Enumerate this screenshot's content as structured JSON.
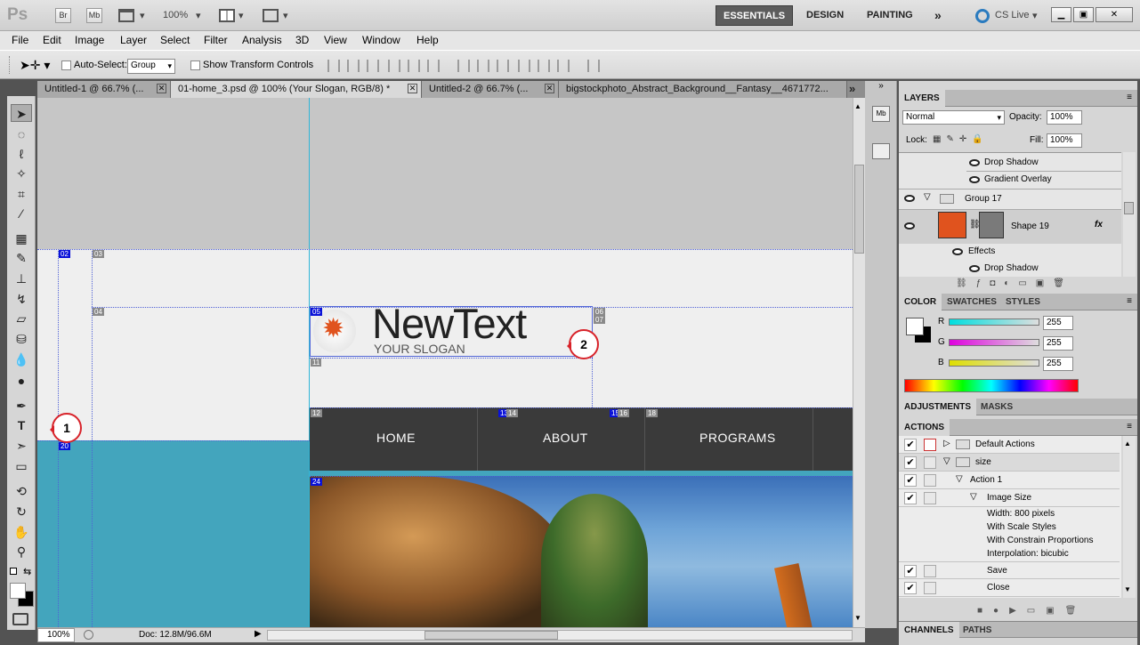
{
  "appbar": {
    "logo": "Ps",
    "bridge": "Br",
    "minibridge": "Mb",
    "zoom": "100%",
    "workspaces": [
      "ESSENTIALS",
      "DESIGN",
      "PAINTING"
    ],
    "more": "»",
    "cslive": "CS Live"
  },
  "menu": [
    "File",
    "Edit",
    "Image",
    "Layer",
    "Select",
    "Filter",
    "Analysis",
    "3D",
    "View",
    "Window",
    "Help"
  ],
  "options": {
    "auto_select_label": "Auto-Select:",
    "auto_select_value": "Group",
    "transform_label": "Show Transform Controls"
  },
  "tabs": [
    {
      "label": "Untitled-1 @ 66.7% (...",
      "close": "✕"
    },
    {
      "label": "01-home_3.psd @ 100% (Your Slogan, RGB/8) *",
      "close": "✕"
    },
    {
      "label": "Untitled-2 @ 66.7% (...",
      "close": "✕"
    },
    {
      "label": "bigstockphoto_Abstract_Background__Fantasy__4671772...",
      "close": "✕"
    }
  ],
  "tabs_more": "»",
  "canvas": {
    "slices": [
      "02",
      "03",
      "04",
      "05",
      "06",
      "07",
      "11",
      "12",
      "13",
      "14",
      "15",
      "16",
      "18",
      "20",
      "24"
    ],
    "logo_text": "NewText",
    "slogan": "YOUR SLOGAN",
    "nav": [
      "HOME",
      "ABOUT",
      "PROGRAMS"
    ],
    "callouts": [
      "1",
      "2"
    ]
  },
  "status": {
    "zoom": "100%",
    "doc": "Doc: 12.8M/96.6M"
  },
  "layers_panel": {
    "tab": "LAYERS",
    "blend": "Normal",
    "opacity_label": "Opacity:",
    "opacity": "100%",
    "lock_label": "Lock:",
    "fill_label": "Fill:",
    "fill": "100%",
    "rows": [
      "Drop Shadow",
      "Gradient Overlay",
      "Group 17",
      "Shape 19",
      "Effects",
      "Drop Shadow"
    ],
    "fx": "fx"
  },
  "color_panel": {
    "tabs": [
      "COLOR",
      "SWATCHES",
      "STYLES"
    ],
    "channels": [
      {
        "label": "R",
        "value": "255",
        "color": "#00e8e8"
      },
      {
        "label": "G",
        "value": "255",
        "color": "#e800e8"
      },
      {
        "label": "B",
        "value": "255",
        "color": "#e8e800"
      }
    ]
  },
  "adjust_tabs": [
    "ADJUSTMENTS",
    "MASKS"
  ],
  "actions_panel": {
    "tab": "ACTIONS",
    "rows": [
      "Default Actions",
      "size",
      "Action 1",
      "Image Size",
      "Width: 800 pixels",
      "With Scale Styles",
      "With Constrain Proportions",
      "Interpolation: bicubic",
      "Save",
      "Close"
    ]
  },
  "bottom_tabs": [
    "CHANNELS",
    "PATHS"
  ],
  "colors": {
    "accent_orange": "#e0531e",
    "teal": "#43a5bd",
    "nav_dark": "#3a3a3a",
    "slice_blue": "#0a12d8"
  }
}
